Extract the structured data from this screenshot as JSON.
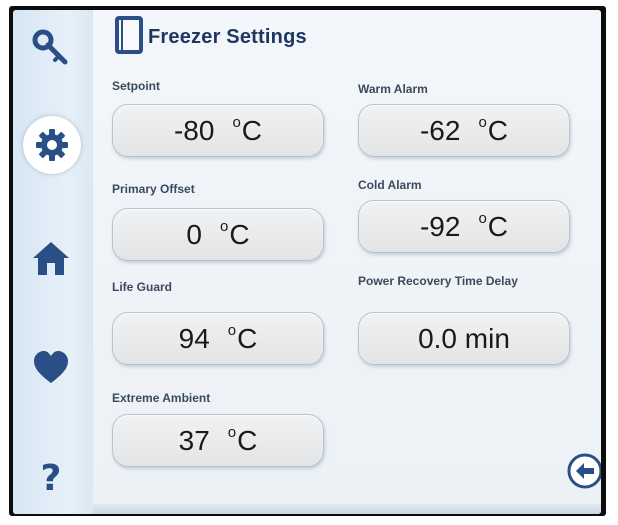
{
  "header": {
    "title": "Freezer Settings"
  },
  "sidebar": {
    "items": [
      {
        "icon": "key-icon",
        "label": ""
      },
      {
        "icon": "gear-icon",
        "label": "",
        "active": true
      },
      {
        "icon": "home-icon",
        "label": ""
      },
      {
        "icon": "heart-icon",
        "label": ""
      },
      {
        "icon": "question-icon",
        "label": ""
      }
    ]
  },
  "settings": {
    "setpoint": {
      "label": "Setpoint",
      "value": "-80",
      "unit": "C"
    },
    "warm_alarm": {
      "label": "Warm Alarm",
      "value": "-62",
      "unit": "C"
    },
    "primary_offset": {
      "label": "Primary Offset",
      "value": "0",
      "unit": "C"
    },
    "cold_alarm": {
      "label": "Cold Alarm",
      "value": "-92",
      "unit": "C"
    },
    "life_guard": {
      "label": "Life Guard",
      "value": "94",
      "unit": "C"
    },
    "power_recovery": {
      "label": "Power Recovery Time Delay",
      "value": "0.0 min"
    },
    "extreme_ambient": {
      "label": "Extreme Ambient",
      "value": "37",
      "unit": "C"
    }
  },
  "colors": {
    "accent": "#2a4e86",
    "title": "#1e3760",
    "field_bg": "#e8e9ea"
  }
}
